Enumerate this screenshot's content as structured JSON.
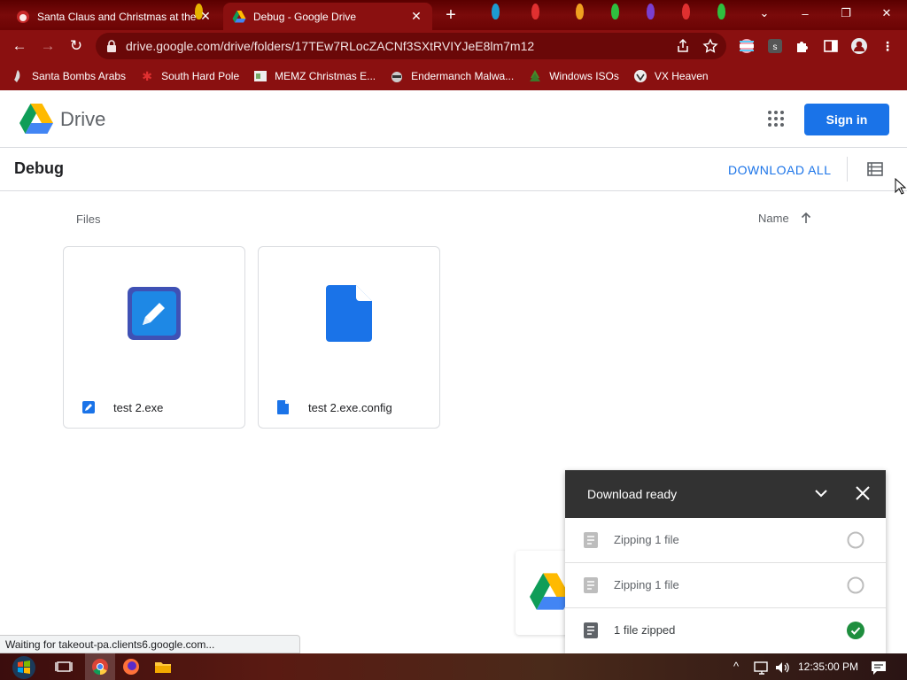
{
  "browser": {
    "tabs": [
      {
        "title": "Santa Claus and Christmas at the",
        "active": false
      },
      {
        "title": "Debug - Google Drive",
        "active": true
      }
    ],
    "new_tab": "+",
    "window_controls": {
      "chevron": "⌄",
      "minimize": "–",
      "restore": "❐",
      "close": "✕"
    },
    "url": "drive.google.com/drive/folders/17TEw7RLocZACNf3SXtRVIYJeE8lm7m12",
    "bookmarks": [
      {
        "label": "Santa Bombs Arabs",
        "icon": "santa-icon"
      },
      {
        "label": "South Hard Pole",
        "icon": "snowflake-icon"
      },
      {
        "label": "MEMZ Christmas E...",
        "icon": "memz-icon"
      },
      {
        "label": "Endermanch Malwa...",
        "icon": "raccoon-icon"
      },
      {
        "label": "Windows ISOs",
        "icon": "tree-icon"
      },
      {
        "label": "VX Heaven",
        "icon": "vx-icon"
      }
    ]
  },
  "drive": {
    "brand": "Drive",
    "signin_label": "Sign in",
    "folder_title": "Debug",
    "download_all_label": "DOWNLOAD ALL",
    "files_label": "Files",
    "sort_label": "Name",
    "files": [
      {
        "name": "test 2.exe",
        "type": "exe"
      },
      {
        "name": "test 2.exe.config",
        "type": "doc"
      }
    ]
  },
  "download_panel": {
    "title": "Download ready",
    "items": [
      {
        "label": "Zipping 1 file",
        "status": "pending"
      },
      {
        "label": "Zipping 1 file",
        "status": "pending"
      },
      {
        "label": "1 file zipped",
        "status": "done"
      }
    ]
  },
  "status_text": "Waiting for takeout-pa.clients6.google.com...",
  "taskbar": {
    "time": "12:35:00 PM"
  },
  "colors": {
    "accent": "#1a73e8",
    "chrome_red": "#8a1010",
    "success": "#1e8e3e",
    "panel_header": "#323232"
  }
}
